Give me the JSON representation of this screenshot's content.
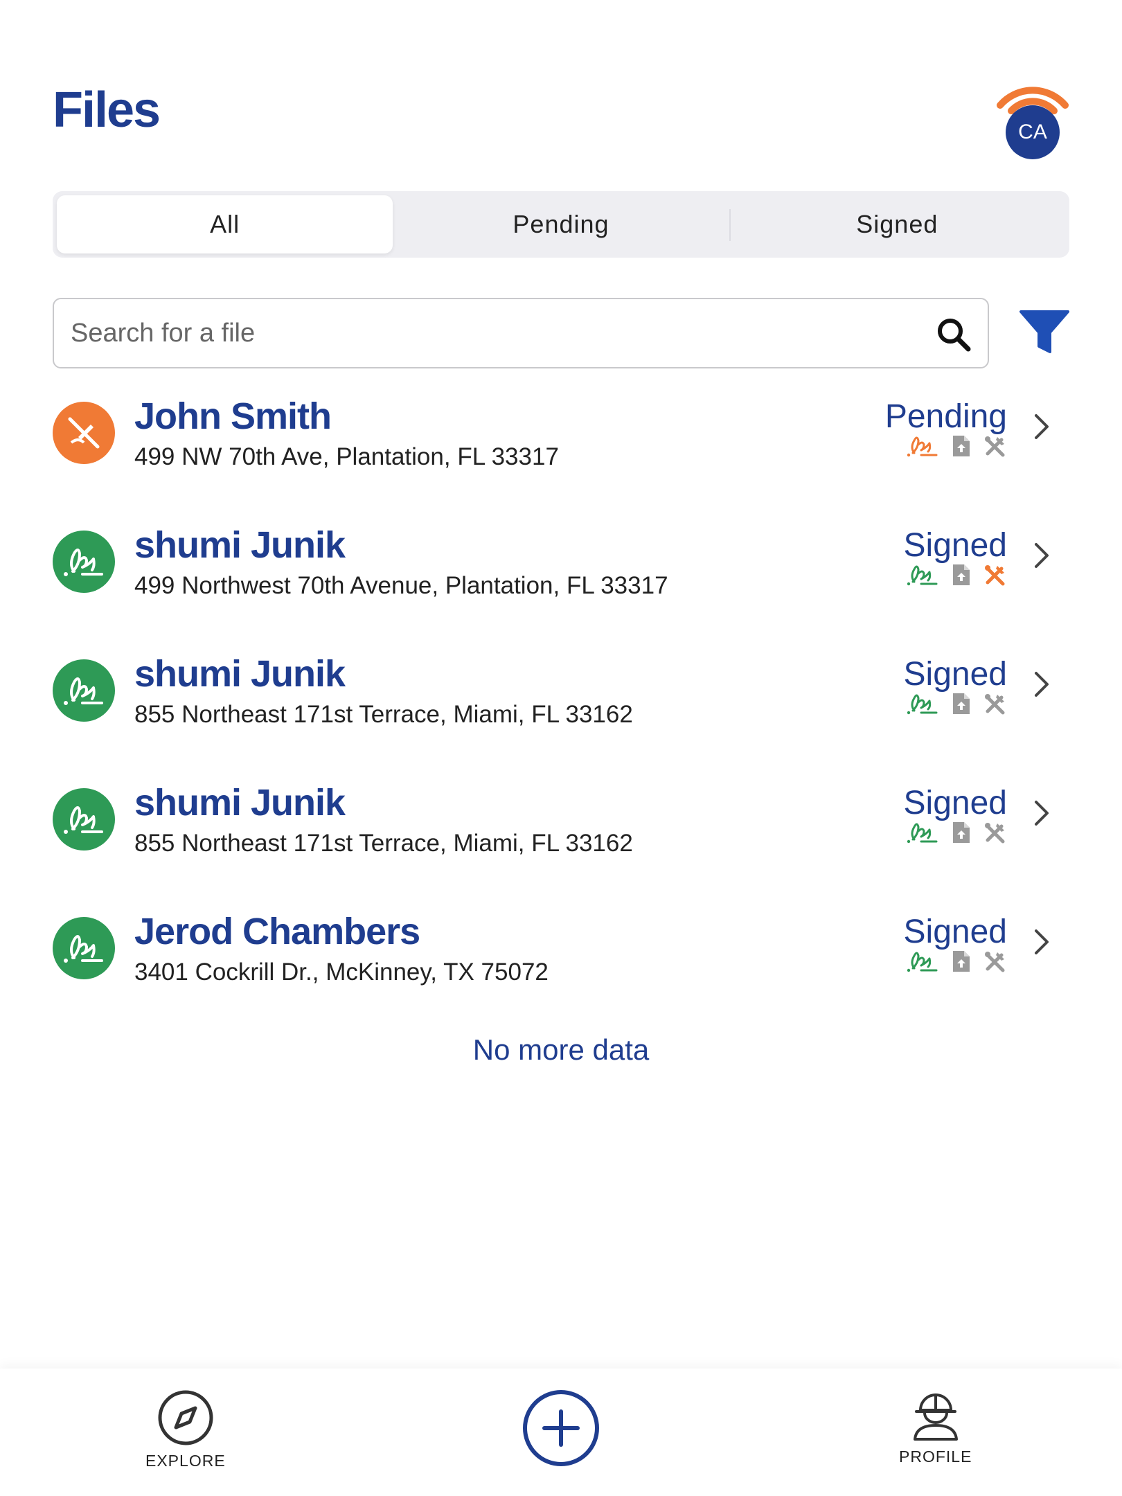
{
  "header": {
    "title": "Files",
    "avatar_initials": "CA",
    "connectivity_icon": "wifi-icon",
    "accent_color": "#f07a35",
    "brand_color": "#1f3d8f"
  },
  "tabs": [
    {
      "label": "All",
      "active": true
    },
    {
      "label": "Pending",
      "active": false
    },
    {
      "label": "Signed",
      "active": false
    }
  ],
  "search": {
    "placeholder": "Search for a file",
    "value": "",
    "icon": "search-icon",
    "filter_icon": "filter-icon"
  },
  "files": [
    {
      "name": "John Smith",
      "address": "499 NW 70th Ave, Plantation, FL 33317",
      "status": "Pending",
      "avatar": "signature-off-icon",
      "avatar_color": "#f07a35",
      "signature_color": "#f07a35",
      "document_color": "#9a9a9a",
      "tools_color": "#9a9a9a"
    },
    {
      "name": "shumi Junik",
      "address": "499 Northwest 70th Avenue, Plantation, FL 33317",
      "status": "Signed",
      "avatar": "signature-icon",
      "avatar_color": "#2e9a56",
      "signature_color": "#2e9a56",
      "document_color": "#9a9a9a",
      "tools_color": "#f07a35"
    },
    {
      "name": "shumi Junik",
      "address": "855 Northeast 171st Terrace, Miami, FL 33162",
      "status": "Signed",
      "avatar": "signature-icon",
      "avatar_color": "#2e9a56",
      "signature_color": "#2e9a56",
      "document_color": "#9a9a9a",
      "tools_color": "#9a9a9a"
    },
    {
      "name": "shumi Junik",
      "address": "855 Northeast 171st Terrace, Miami, FL 33162",
      "status": "Signed",
      "avatar": "signature-icon",
      "avatar_color": "#2e9a56",
      "signature_color": "#2e9a56",
      "document_color": "#9a9a9a",
      "tools_color": "#9a9a9a"
    },
    {
      "name": "Jerod Chambers",
      "address": "3401 Cockrill Dr., McKinney, TX 75072",
      "status": "Signed",
      "avatar": "signature-icon",
      "avatar_color": "#2e9a56",
      "signature_color": "#2e9a56",
      "document_color": "#9a9a9a",
      "tools_color": "#9a9a9a"
    }
  ],
  "footer_message": "No more data",
  "bottom_nav": {
    "explore_label": "EXPLORE",
    "explore_icon": "compass-icon",
    "add_icon": "plus-circle-icon",
    "profile_label": "PROFILE",
    "profile_icon": "worker-helmet-icon"
  }
}
